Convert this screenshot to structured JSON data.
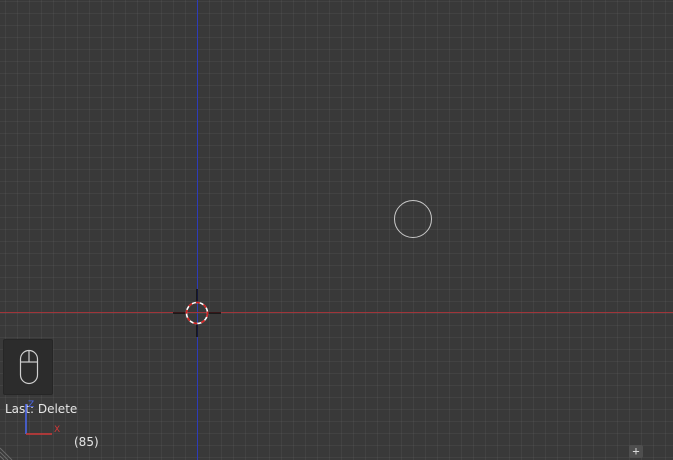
{
  "viewport": {
    "background_color": "#393939",
    "axis_x_color": "#a0353a",
    "axis_z_color": "#2d3bb8"
  },
  "status": {
    "last_operation": "Last: Delete",
    "frame_counter": "(85)"
  },
  "mini_axes": {
    "z_label": "Z",
    "x_label": "X",
    "z_color": "#4a66e8",
    "x_color": "#d03838"
  },
  "icons": {
    "mouse": "mouse-icon",
    "cursor": "3d-cursor-icon",
    "add": "plus-icon",
    "corner": "area-corner-grip-icon",
    "empty": "empty-circle-object"
  },
  "add_button": {
    "label": "+"
  }
}
